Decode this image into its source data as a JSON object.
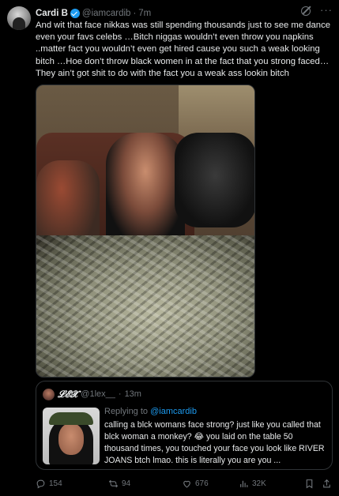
{
  "tweet": {
    "author_name": "Cardi B",
    "author_handle": "@iamcardib",
    "separator": "·",
    "time": "7m",
    "more_icon": "···",
    "text": "And wit that face nikkas was still spending thousands just to see me dance even your favs celebs …Bitch niggas wouldn’t even throw you napkins ..matter fact you wouldn’t even get hired cause you such a weak looking bitch …Hoe don’t throw black women in at the fact that you strong faced… They ain’t got shit to do with the fact you a weak ass lookin bitch"
  },
  "quote": {
    "author_name": "𝓛𝓔𝓧",
    "author_handle": "@1lex__",
    "separator": "·",
    "time": "13m",
    "reply_prefix": "Replying to",
    "reply_handle": "@iamcardib",
    "text": "calling a blck womans face strong? just like you called that blck woman a monkey? 😂 you laid on the table 50 thousand times, you touched your face you look like RIVER JOANS btch lmao. this is literally you are you ..."
  },
  "actions": {
    "replies": "154",
    "reposts": "94",
    "likes": "676",
    "views": "32K"
  }
}
